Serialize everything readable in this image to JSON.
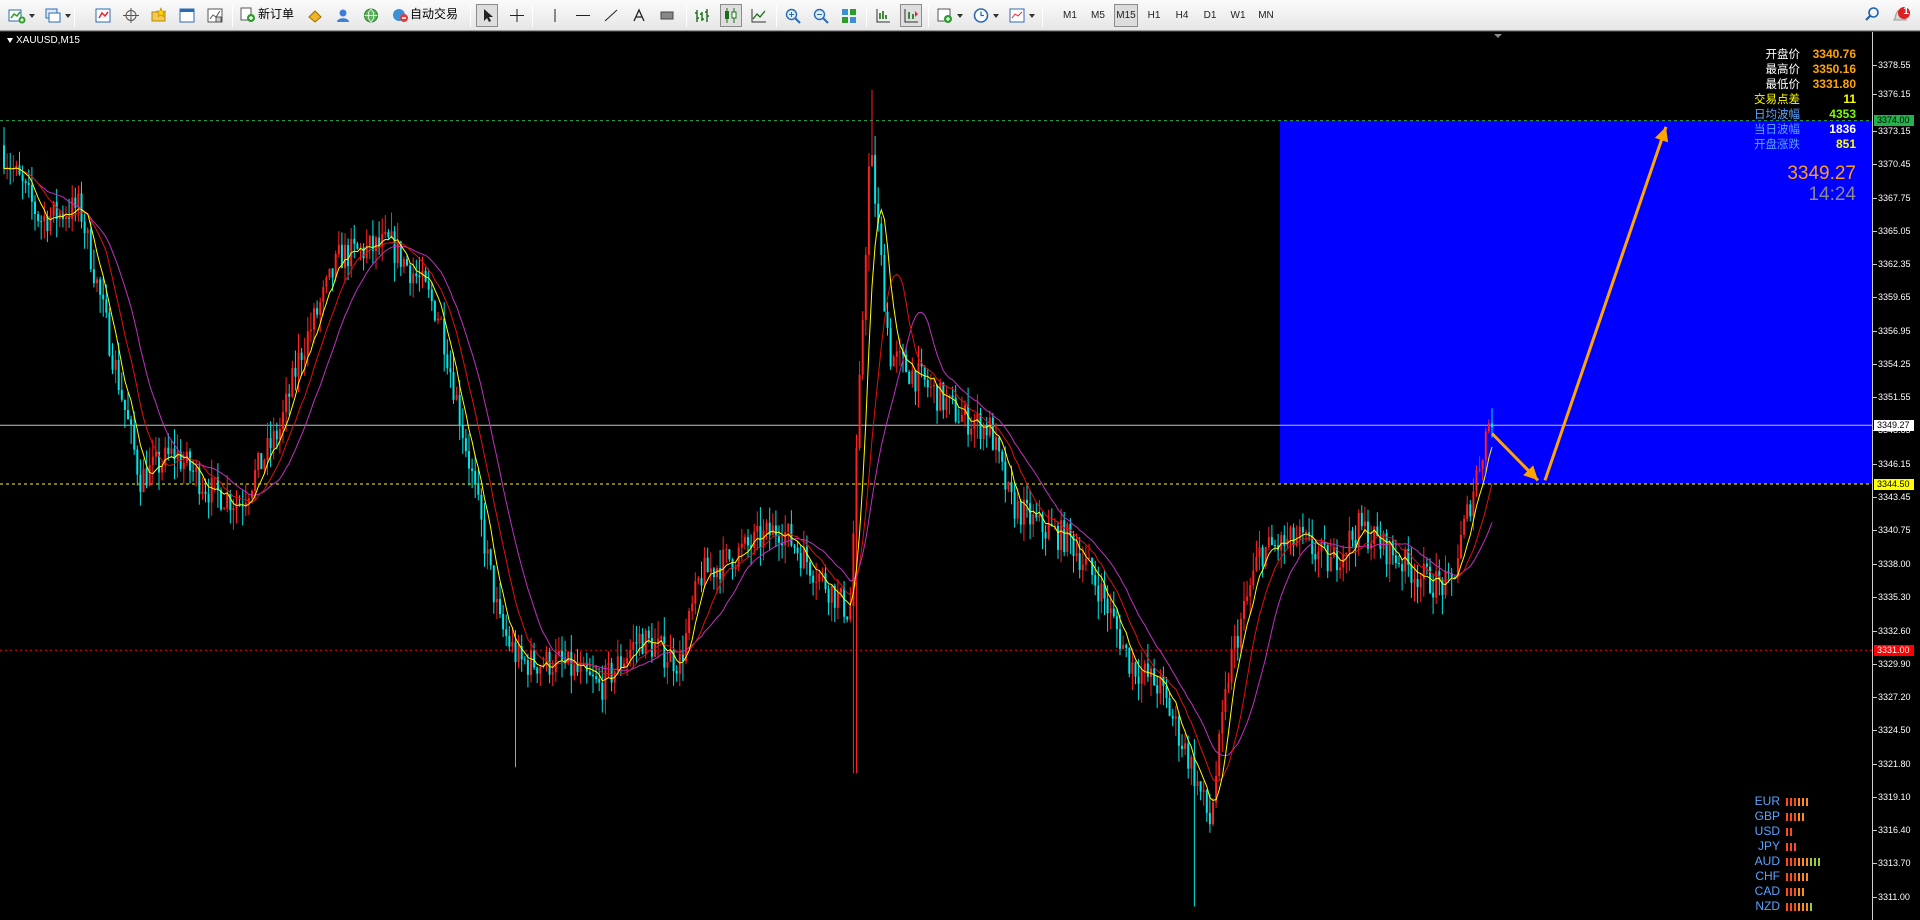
{
  "toolbar": {
    "new_order_label": "新订单",
    "auto_trade_label": "自动交易",
    "timeframes": [
      "M1",
      "M5",
      "M15",
      "H1",
      "H4",
      "D1",
      "W1",
      "MN"
    ],
    "active_timeframe": "M15",
    "notification_count": "1"
  },
  "chart": {
    "symbol_label": "XAUUSD,M15",
    "price_axis": {
      "min": 3309.1,
      "max": 3381.2,
      "ticks": [
        "3378.55",
        "3376.15",
        "3373.15",
        "3370.45",
        "3367.75",
        "3365.05",
        "3362.35",
        "3359.65",
        "3356.95",
        "3354.25",
        "3351.55",
        "3348.85",
        "3346.15",
        "3343.45",
        "3340.75",
        "3338.00",
        "3335.30",
        "3332.60",
        "3329.90",
        "3327.20",
        "3324.50",
        "3321.80",
        "3319.10",
        "3316.40",
        "3313.70",
        "3311.00"
      ]
    },
    "price_tags": [
      {
        "name": "target-level",
        "value": "3374.00",
        "price": 3374.0,
        "bg": "#22b14c",
        "fg": "#000000"
      },
      {
        "name": "current-price",
        "value": "3349.27",
        "price": 3349.27,
        "bg": "#ffffff",
        "fg": "#000000"
      },
      {
        "name": "support-level",
        "value": "3344.50",
        "price": 3344.5,
        "bg": "#ffff00",
        "fg": "#000000"
      },
      {
        "name": "stop-level",
        "value": "3331.00",
        "price": 3331.0,
        "bg": "#ff0000",
        "fg": "#ffffff"
      }
    ],
    "colors": {
      "bull_candle": "#ff2020",
      "bear_candle": "#00e5e5",
      "ma_fast": "#ffff00",
      "ma_mid": "#e01010",
      "ma_slow": "#c030c0",
      "zone": "#0000ff",
      "arrow": "#ffa500"
    }
  },
  "info_panel": {
    "rows": [
      {
        "label": "开盘价",
        "value": "3340.76",
        "label_color": "#ffffff",
        "value_color": "#ffa500"
      },
      {
        "label": "最高价",
        "value": "3350.16",
        "label_color": "#ffffff",
        "value_color": "#ffa500"
      },
      {
        "label": "最低价",
        "value": "3331.80",
        "label_color": "#ffffff",
        "value_color": "#ffa500"
      },
      {
        "label": "交易点差",
        "value": "11",
        "label_color": "#ffff00",
        "value_color": "#ffff00"
      },
      {
        "label": "日均波幅",
        "value": "4353",
        "label_color": "#59a4ff",
        "value_color": "#7cfc00"
      },
      {
        "label": "当日波幅",
        "value": "1836",
        "label_color": "#59a4ff",
        "value_color": "#ffffff"
      },
      {
        "label": "开盘涨跌",
        "value": "851",
        "label_color": "#59a4ff",
        "value_color": "#ffff00"
      }
    ],
    "price": "3349.27",
    "time": "14:24"
  },
  "currency_strength": [
    {
      "name": "EUR",
      "strength": 6
    },
    {
      "name": "GBP",
      "strength": 5
    },
    {
      "name": "USD",
      "strength": 2
    },
    {
      "name": "JPY",
      "strength": 3
    },
    {
      "name": "AUD",
      "strength": 9
    },
    {
      "name": "CHF",
      "strength": 6
    },
    {
      "name": "CAD",
      "strength": 5
    },
    {
      "name": "NZD",
      "strength": 7
    }
  ]
}
